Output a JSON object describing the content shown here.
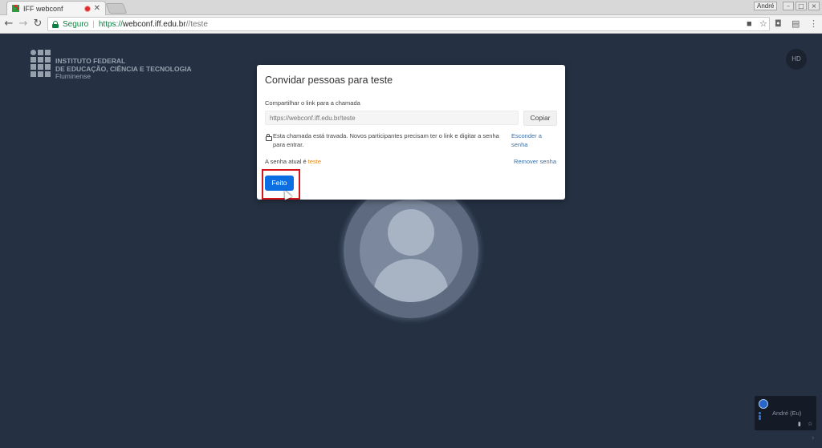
{
  "browser": {
    "tab": {
      "title": "IFF webconf",
      "close": "✕"
    },
    "profile": "André",
    "url": {
      "secure_label": "Seguro",
      "separator": "|",
      "protocol": "https://",
      "host": "webconf.iff.edu.br",
      "path": "//teste"
    },
    "icons": [
      "back-icon",
      "forward-icon",
      "reload-icon",
      "lock-icon",
      "camera-icon",
      "star-icon",
      "screenshot-icon",
      "extension-icon",
      "menu-icon"
    ]
  },
  "page": {
    "logo": {
      "line1": "INSTITUTO FEDERAL",
      "line2": "DE EDUCAÇÃO, CIÊNCIA E TECNOLOGIA",
      "line3": "Fluminense"
    },
    "quality_badge": "HD",
    "thumbnail": {
      "name": "André (Eu)"
    }
  },
  "dialog": {
    "title": "Convidar pessoas para teste",
    "share_label": "Compartilhar o link para a chamada",
    "link_placeholder": "https://webconf.iff.edu.br/teste",
    "copy_label": "Copiar",
    "locked_message": "Esta chamada está travada. Novos participantes precisam ter o link e digitar a senha para entrar.",
    "hide_password_label": "Esconder a senha",
    "password_prefix": "A senha atual é ",
    "password_value": "teste",
    "remove_password_label": "Remover senha",
    "done_label": "Feito"
  },
  "colors": {
    "accent": "#0b6ee3",
    "link": "#3b6fa5",
    "password": "#e08b1b",
    "highlight": "#d8141b",
    "background": "#253143"
  }
}
